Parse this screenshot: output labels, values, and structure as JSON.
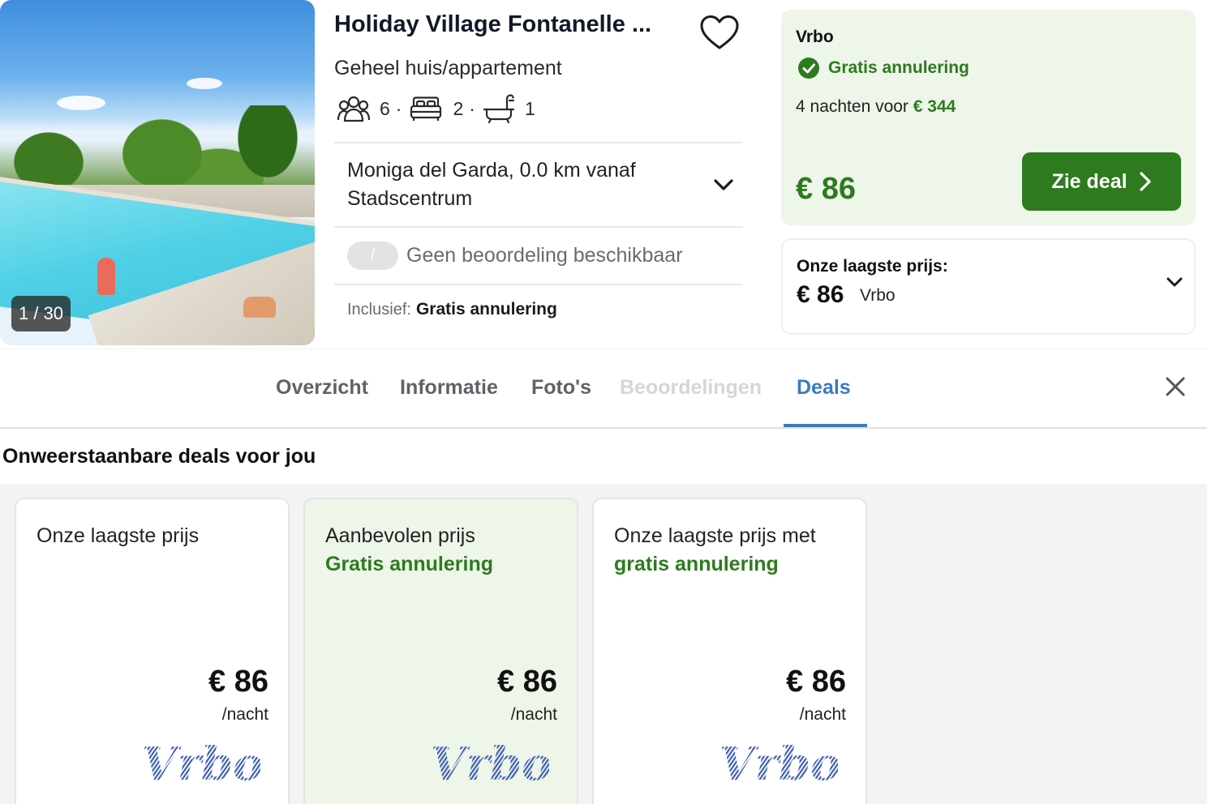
{
  "gallery": {
    "counter": "1 / 30"
  },
  "hotel": {
    "title": "Holiday Village Fontanelle ...",
    "type": "Geheel huis/appartement",
    "guests": "6",
    "bedrooms": "2",
    "bathrooms": "1",
    "location": "Moniga del Garda, 0.0 km vanaf Stadscentrum",
    "rating_pill": "/",
    "rating_text": "Geen beoordeling beschikbaar",
    "included_label": "Inclusief:",
    "included_value": "Gratis annulering"
  },
  "deal": {
    "provider": "Vrbo",
    "cancellation": "Gratis annulering",
    "nights_text": "4 nachten voor",
    "nights_price": "€ 344",
    "price": "€ 86",
    "button_label": "Zie deal"
  },
  "lowest": {
    "label": "Onze laagste prijs:",
    "price": "€ 86",
    "provider": "Vrbo"
  },
  "tabs": [
    {
      "label": "Overzicht",
      "state": "normal"
    },
    {
      "label": "Informatie",
      "state": "normal"
    },
    {
      "label": "Foto's",
      "state": "normal"
    },
    {
      "label": "Beoordelingen",
      "state": "disabled"
    },
    {
      "label": "Deals",
      "state": "active"
    }
  ],
  "section_title": "Onweerstaanbare deals voor jou",
  "cards": [
    {
      "title": "Onze laagste prijs",
      "subtitle": "",
      "price": "€ 86",
      "per": "/nacht",
      "logo": "Vrbo"
    },
    {
      "title": "Aanbevolen prijs",
      "subtitle": "Gratis annulering",
      "price": "€ 86",
      "per": "/nacht",
      "logo": "Vrbo"
    },
    {
      "title": "Onze laagste prijs met",
      "subtitle": "gratis annulering",
      "price": "€ 86",
      "per": "/nacht",
      "logo": "Vrbo"
    }
  ],
  "colors": {
    "green": "#2e7a1f",
    "deal_bg": "#eef5e9",
    "tab_active": "#3a7bbd",
    "vrbo_logo": "#3f5fb5"
  },
  "icons": [
    "heart-icon",
    "guests-icon",
    "bed-icon",
    "bathtub-icon",
    "chevron-down-icon",
    "check-circle-icon",
    "chevron-right-icon",
    "close-icon"
  ]
}
